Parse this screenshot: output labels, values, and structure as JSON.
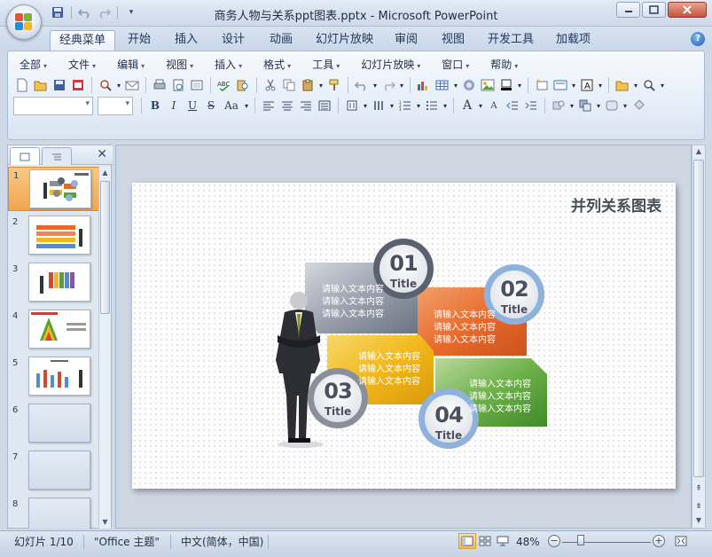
{
  "window": {
    "title": "商务人物与关系ppt图表.pptx - Microsoft PowerPoint"
  },
  "ribbon_tabs": [
    {
      "label": "经典菜单",
      "active": true
    },
    {
      "label": "开始"
    },
    {
      "label": "插入"
    },
    {
      "label": "设计"
    },
    {
      "label": "动画"
    },
    {
      "label": "幻灯片放映"
    },
    {
      "label": "审阅"
    },
    {
      "label": "视图"
    },
    {
      "label": "开发工具"
    },
    {
      "label": "加载项"
    }
  ],
  "menus": [
    "全部",
    "文件",
    "编辑",
    "视图",
    "插入",
    "格式",
    "工具",
    "幻灯片放映",
    "窗口",
    "帮助"
  ],
  "format_buttons": {
    "bold": "B",
    "italic": "I",
    "underline": "U",
    "strike": "S",
    "case": "Aa",
    "font_grow": "A",
    "font_shrink": "A"
  },
  "slides_panel": {
    "slides": [
      "1",
      "2",
      "3",
      "4",
      "5",
      "6",
      "7",
      "8"
    ],
    "selected": "1"
  },
  "slide": {
    "title": "并列关系图表",
    "items": [
      {
        "number": "01",
        "title": "Title",
        "lines": [
          "请输入文本内容",
          "请输入文本内容",
          "请输入文本内容"
        ],
        "color": "#5a6270"
      },
      {
        "number": "02",
        "title": "Title",
        "lines": [
          "请输入文本内容",
          "请输入文本内容",
          "请输入文本内容"
        ],
        "color": "#e8682a"
      },
      {
        "number": "03",
        "title": "Title",
        "lines": [
          "请输入文本内容",
          "请输入文本内容",
          "请输入文本内容"
        ],
        "color": "#f2b81a"
      },
      {
        "number": "04",
        "title": "Title",
        "lines": [
          "请输入文本内容",
          "请输入文本内容",
          "请输入文本内容"
        ],
        "color": "#58a03a"
      }
    ]
  },
  "status": {
    "slide_info": "幻灯片 1/10",
    "theme": "\"Office 主题\"",
    "language": "中文(简体，中国)",
    "zoom": "48%",
    "zoom_minus": "−",
    "zoom_plus": "+"
  },
  "colors": {
    "accent_tab": "#ffffff",
    "selected_thumb": "#f3a44e"
  }
}
